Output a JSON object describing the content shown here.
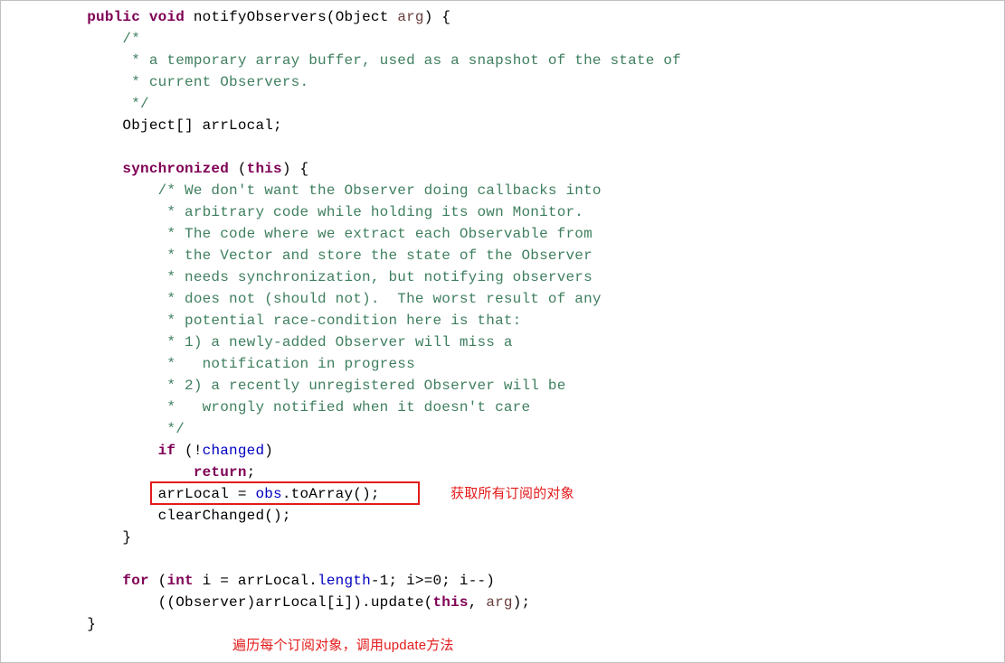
{
  "tokens": {
    "public": "public",
    "void": "void",
    "synchronized": "synchronized",
    "this": "this",
    "if": "if",
    "return": "return",
    "for": "for",
    "int": "int",
    "arg": "arg",
    "obs": "obs",
    "changed": "changed",
    "length": "length"
  },
  "lines": {
    "sig_a": " notifyObservers(Object ",
    "sig_b": ") {",
    "c1": "/*",
    "c2": " * a temporary array buffer, used as a snapshot of the state of",
    "c3": " * current Observers.",
    "c4": " */",
    "decl": "Object[] arrLocal;",
    "sync_a": " (",
    "sync_b": ") {",
    "bc01": "/* We don't want the Observer doing callbacks into",
    "bc02": " * arbitrary code while holding its own Monitor.",
    "bc03": " * The code where we extract each Observable from",
    "bc04": " * the Vector and store the state of the Observer",
    "bc05": " * needs synchronization, but notifying observers",
    "bc06": " * does not (should not).  The worst result of any",
    "bc07": " * potential race-condition here is that:",
    "bc08": " * 1) a newly-added Observer will miss a",
    "bc09": " *   notification in progress",
    "bc10": " * 2) a recently unregistered Observer will be",
    "bc11": " *   wrongly notified when it doesn't care",
    "bc12": " */",
    "if_a": " (!",
    "if_b": ")",
    "ret_tail": ";",
    "arr_a": "arrLocal = ",
    "arr_b": ".toArray();",
    "clear": "clearChanged();",
    "close_inner": "}",
    "for_a": " (",
    "for_b": " i = arrLocal.",
    "for_c": "-1; i>=0; i--)",
    "upd_a": "((Observer)arrLocal[i]).update(",
    "upd_b": ", ",
    "upd_c": ");",
    "close_outer": "}"
  },
  "indent": {
    "i1": "    ",
    "i2": "        ",
    "i3": "            ",
    "i4": "                "
  },
  "annotations": {
    "a1": "获取所有订阅的对象",
    "a2": "遍历每个订阅对象，调用update方法"
  }
}
